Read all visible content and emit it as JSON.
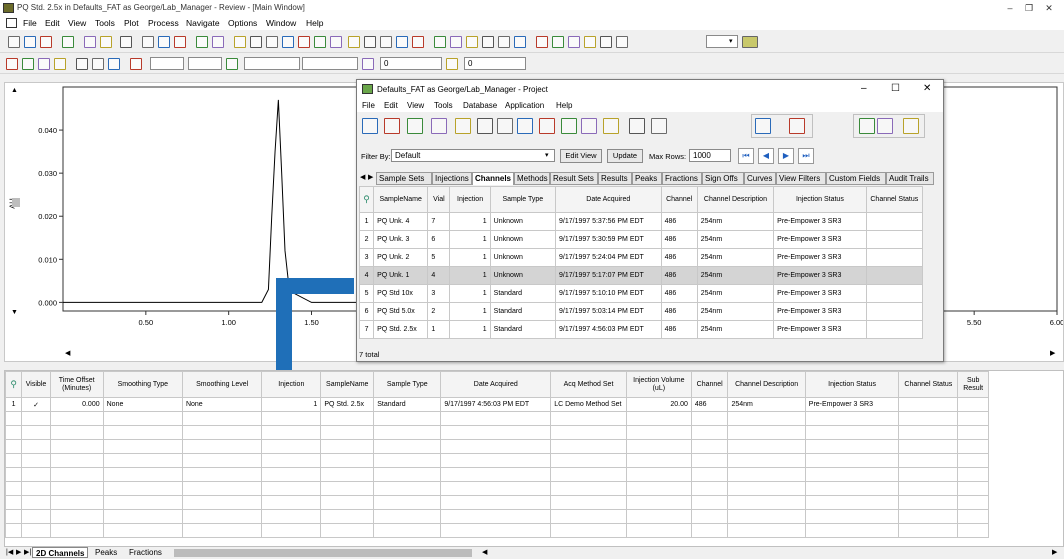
{
  "main_window": {
    "title": "PQ Std. 2.5x in Defaults_FAT as George/Lab_Manager - Review - [Main Window]",
    "minimize": "–",
    "restore": "❐",
    "close": "✕"
  },
  "menu": [
    "File",
    "Edit",
    "View",
    "Tools",
    "Plot",
    "Process",
    "Navigate",
    "Options",
    "Window",
    "Help"
  ],
  "toolbar2": {
    "field1": "0",
    "field2": "0"
  },
  "chart": {
    "ylabel": "AU"
  },
  "chart_data": {
    "type": "line",
    "title": "",
    "xlabel": "",
    "ylabel": "AU",
    "xlim": [
      0.0,
      6.0
    ],
    "ylim": [
      -0.002,
      0.05
    ],
    "x_ticks": [
      "0.50",
      "1.00",
      "1.50",
      "5.50",
      "6.00"
    ],
    "y_ticks": [
      "0.000",
      "0.010",
      "0.020",
      "0.030",
      "0.040"
    ],
    "series": [
      {
        "x": [
          0.0,
          0.5,
          0.9,
          1.1,
          1.2,
          1.24,
          1.26,
          1.28,
          1.3,
          1.32,
          1.34,
          1.36,
          1.4,
          1.5,
          1.8,
          2.0
        ],
        "y": [
          0.0,
          0.0,
          0.0,
          0.0,
          0.0,
          0.003,
          0.02,
          0.035,
          0.047,
          0.03,
          0.012,
          0.005,
          0.002,
          0.0,
          0.0,
          0.0
        ]
      }
    ]
  },
  "project": {
    "title": "Defaults_FAT as George/Lab_Manager - Project",
    "menu": [
      "File",
      "Edit",
      "View",
      "Tools",
      "Database",
      "Application",
      "Help"
    ],
    "filter_label": "Filter By:",
    "filter_value": "Default",
    "edit_view": "Edit View",
    "update": "Update",
    "max_rows_label": "Max Rows:",
    "max_rows": "1000",
    "tabs": [
      "Sample Sets",
      "Injections",
      "Channels",
      "Methods",
      "Result Sets",
      "Results",
      "Peaks",
      "Fractions",
      "Sign Offs",
      "Curves",
      "View Filters",
      "Custom Fields",
      "Audit Trails"
    ],
    "active_tab": "Channels",
    "columns": [
      "SampleName",
      "Vial",
      "Injection",
      "Sample Type",
      "Date Acquired",
      "Channel",
      "Channel Description",
      "Injection Status",
      "Channel Status"
    ],
    "rows": [
      [
        "1",
        "PQ Unk. 4",
        "7",
        "1",
        "Unknown",
        "9/17/1997 5:37:56 PM EDT",
        "486",
        "254nm",
        "Pre-Empower 3 SR3",
        ""
      ],
      [
        "2",
        "PQ Unk. 3",
        "6",
        "1",
        "Unknown",
        "9/17/1997 5:30:59 PM EDT",
        "486",
        "254nm",
        "Pre-Empower 3 SR3",
        ""
      ],
      [
        "3",
        "PQ Unk. 2",
        "5",
        "1",
        "Unknown",
        "9/17/1997 5:24:04 PM EDT",
        "486",
        "254nm",
        "Pre-Empower 3 SR3",
        ""
      ],
      [
        "4",
        "PQ Unk. 1",
        "4",
        "1",
        "Unknown",
        "9/17/1997 5:17:07 PM EDT",
        "486",
        "254nm",
        "Pre-Empower 3 SR3",
        ""
      ],
      [
        "5",
        "PQ Std 10x",
        "3",
        "1",
        "Standard",
        "9/17/1997 5:10:10 PM EDT",
        "486",
        "254nm",
        "Pre-Empower 3 SR3",
        ""
      ],
      [
        "6",
        "PQ Std 5.0x",
        "2",
        "1",
        "Standard",
        "9/17/1997 5:03:14 PM EDT",
        "486",
        "254nm",
        "Pre-Empower 3 SR3",
        ""
      ],
      [
        "7",
        "PQ Std. 2.5x",
        "1",
        "1",
        "Standard",
        "9/17/1997 4:56:03 PM EDT",
        "486",
        "254nm",
        "Pre-Empower 3 SR3",
        ""
      ]
    ],
    "selected_row": 3,
    "status": "7 total"
  },
  "bottom_grid": {
    "columns": [
      "Visible",
      "Time Offset (Minutes)",
      "Smoothing Type",
      "Smoothing Level",
      "Injection",
      "SampleName",
      "Sample Type",
      "Date Acquired",
      "Acq Method Set",
      "Injection Volume (uL)",
      "Channel",
      "Channel Description",
      "Injection Status",
      "Channel Status",
      "Sub Result"
    ],
    "row": [
      "1",
      "✓",
      "0.000",
      "None",
      "None",
      "1",
      "PQ Std. 2.5x",
      "Standard",
      "9/17/1997 4:56:03 PM EDT",
      "LC Demo Method Set",
      "20.00",
      "486",
      "254nm",
      "Pre-Empower 3 SR3",
      "",
      ""
    ]
  },
  "bottom_tabs": [
    "2D Channels",
    "Peaks",
    "Fractions"
  ],
  "arrow_color": "#1f6fb8"
}
